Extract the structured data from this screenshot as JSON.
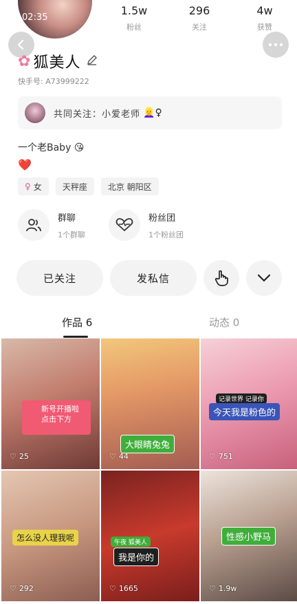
{
  "header": {
    "time": "02:35",
    "stats": [
      {
        "value": "1.5w",
        "label": "粉丝"
      },
      {
        "value": "296",
        "label": "关注"
      },
      {
        "value": "4w",
        "label": "获赞"
      }
    ]
  },
  "profile": {
    "name": "狐美人",
    "kuaishou_id": "快手号: A73999222",
    "mutual_text": "共同关注：小爱老师",
    "mutual_emoji": "👱‍♀️♀",
    "bio_line1": "一个老Baby 😘",
    "bio_line2": "❤️",
    "tags": [
      "女",
      "天秤座",
      "北京 朝阳区"
    ]
  },
  "groups": [
    {
      "title": "群聊",
      "sub": "1个群聊"
    },
    {
      "title": "粉丝团",
      "sub": "1个粉丝团"
    }
  ],
  "actions": {
    "follow": "已关注",
    "message": "发私信"
  },
  "tabs": [
    {
      "label": "作品 6"
    },
    {
      "label": "动态 0"
    }
  ],
  "videos": [
    {
      "likes": "25",
      "caption": "新号开播啦 点击下方"
    },
    {
      "likes": "44",
      "caption": "大眼睛兔兔"
    },
    {
      "likes": "751",
      "caption": "今天我是粉色的",
      "badge": "记录世界 记录你"
    },
    {
      "likes": "292",
      "caption": "怎么没人理我呢"
    },
    {
      "likes": "1665",
      "caption": "我是你的",
      "badge": "午夜 狐美人"
    },
    {
      "likes": "1.9w",
      "caption": "性感小野马"
    }
  ],
  "colors": {
    "accent_pink": "#f07a9b",
    "tab_active": "#222222",
    "tab_inactive": "#999999",
    "badge_green": "#3fae3a"
  }
}
